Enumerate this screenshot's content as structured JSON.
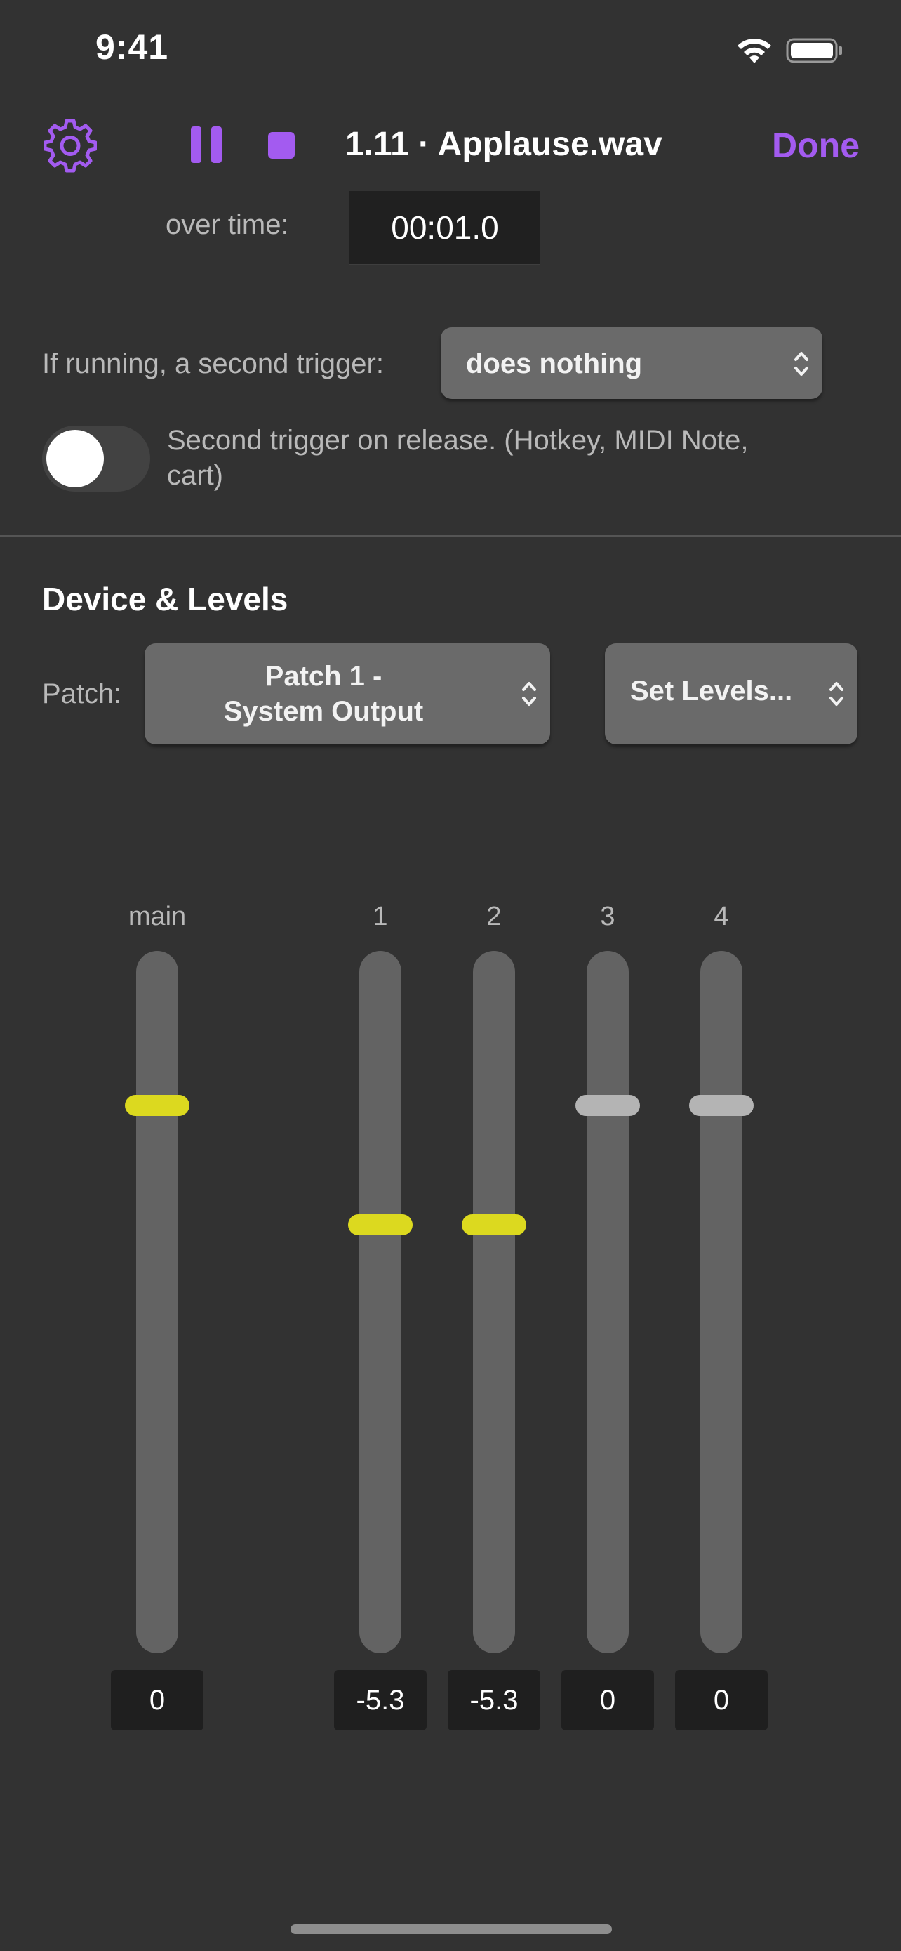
{
  "status_bar": {
    "time": "9:41"
  },
  "toolbar": {
    "gear_icon": "gear-icon",
    "pause_icon": "pause-icon",
    "stop_icon": "stop-icon",
    "cue_title": "1.11 · Applause.wav",
    "done_label": "Done",
    "accent_color": "#a35bf0"
  },
  "over_time": {
    "label": "over time:",
    "value": "00:01.0"
  },
  "second_trigger": {
    "label": "If running, a second trigger:",
    "selected": "does nothing"
  },
  "release_toggle": {
    "label": "Second trigger on release. (Hotkey, MIDI Note, cart)",
    "on": false
  },
  "device_levels": {
    "title": "Device & Levels",
    "patch_label": "Patch:",
    "patch_line1": "Patch 1 -",
    "patch_line2": "System Output",
    "set_levels_label": "Set Levels..."
  },
  "faders": [
    {
      "label": "main",
      "value": "0",
      "level": 0.78,
      "active": true
    },
    {
      "label": "1",
      "value": "-5.3",
      "level": 0.61,
      "active": true
    },
    {
      "label": "2",
      "value": "-5.3",
      "level": 0.61,
      "active": true
    },
    {
      "label": "3",
      "value": "0",
      "level": 0.78,
      "active": false
    },
    {
      "label": "4",
      "value": "0",
      "level": 0.78,
      "active": false
    }
  ],
  "colors": {
    "active_thumb": "#dcd91f",
    "inactive_thumb": "#b4b4b4"
  }
}
